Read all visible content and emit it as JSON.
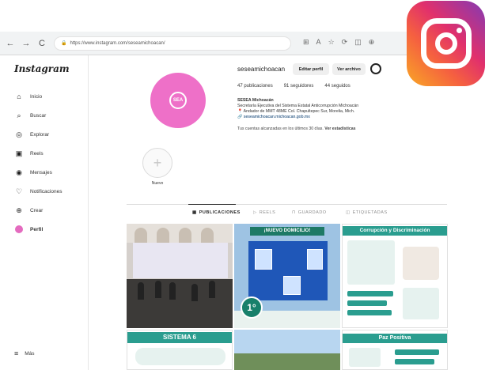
{
  "browser": {
    "url": "https://www.instagram.com/seseamichoacan/",
    "back": "←",
    "forward": "→",
    "reload": "C",
    "lock": "🔒",
    "tools": [
      "⊞",
      "A",
      "☆",
      "⟳",
      "◫",
      "⊕"
    ]
  },
  "sidebar": {
    "logo": "Instagram",
    "items": [
      {
        "icon": "⌂",
        "label": "Inicio"
      },
      {
        "icon": "⌕",
        "label": "Buscar"
      },
      {
        "icon": "◎",
        "label": "Explorar"
      },
      {
        "icon": "▣",
        "label": "Reels"
      },
      {
        "icon": "◉",
        "label": "Mensajes"
      },
      {
        "icon": "♡",
        "label": "Notificaciones"
      },
      {
        "icon": "⊕",
        "label": "Crear"
      },
      {
        "icon": "",
        "label": "Perfil"
      }
    ],
    "more": {
      "icon": "≡",
      "label": "Más"
    }
  },
  "profile": {
    "avatar_text": "SEA",
    "username": "seseamichoacan",
    "edit_label": "Editar perfil",
    "archive_label": "Ver archivo",
    "posts": "47 publicaciones",
    "followers": "91 seguidores",
    "following": "44 seguidos",
    "name": "SESEA Michoacán",
    "bio1": "Secretaría Ejecutiva del Sistema Estatal Anticorrupción Michoacán",
    "bio2": "📍 Andador de MMT 48ME Col. Chapultepec Sur, Morelia, Mich.",
    "link": "🔗 seseamichoacan.michoacan.gob.mx",
    "insights": "Tus cuentas alcanzadas en los últimos 30 días.",
    "insights_link": "Ver estadísticas"
  },
  "highlight": {
    "icon": "+",
    "label": "Nuevo"
  },
  "tabs": [
    {
      "icon": "▦",
      "label": "PUBLICACIONES"
    },
    {
      "icon": "▷",
      "label": "REELS"
    },
    {
      "icon": "⊓",
      "label": "GUARDADO"
    },
    {
      "icon": "◫",
      "label": "ETIQUETADAS"
    }
  ],
  "posts": {
    "p2_banner": "¡NUEVO DOMICILIO!",
    "p2_number": "1°",
    "p3_title": "Corrupción y Discriminación",
    "p4_title": "SISTEMA 6",
    "p6_title": "Paz Positiva"
  },
  "colors": {
    "accent": "#2a9d8f",
    "avatar": "#ee70c8",
    "link": "#00376b"
  }
}
